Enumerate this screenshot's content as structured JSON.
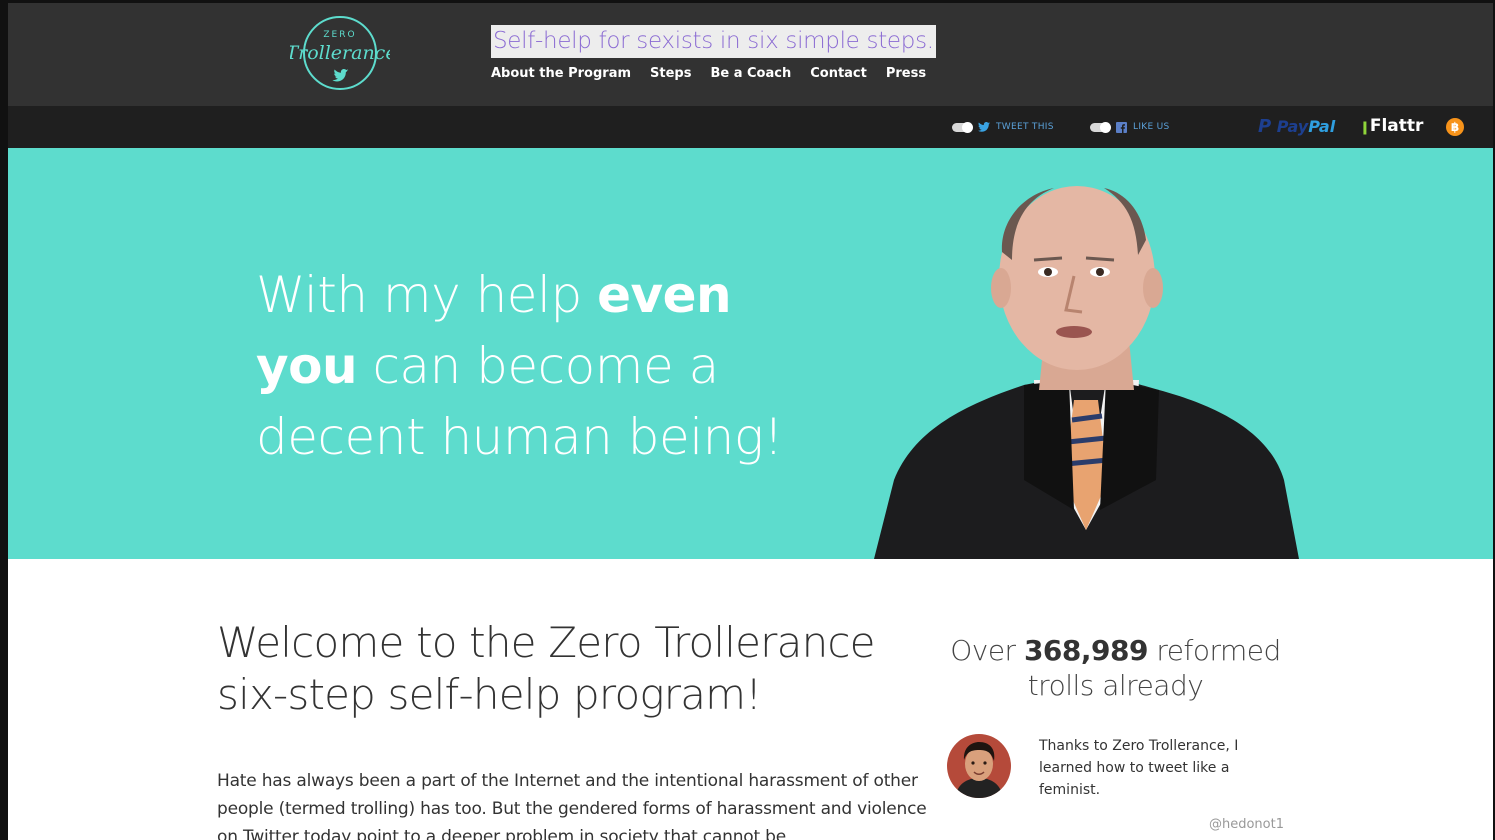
{
  "header": {
    "logo": {
      "top_text": "ZERO",
      "script_text": "Trollerance",
      "icon": "twitter-bird-icon",
      "color": "#5ddccd"
    },
    "tagline": "Self-help for sexists in six simple steps.",
    "nav": [
      {
        "label": "About the Program"
      },
      {
        "label": "Steps"
      },
      {
        "label": "Be a Coach"
      },
      {
        "label": "Contact"
      },
      {
        "label": "Press"
      }
    ]
  },
  "social_bar": {
    "tweet_label": "TWEET THIS",
    "like_label": "LIKE US",
    "paypal_label_1": "Pay",
    "paypal_label_2": "Pal",
    "flattr_label": "Flattr",
    "bitcoin_symbol": "฿"
  },
  "hero": {
    "line1_regular": "With my help ",
    "line1_bold": "even",
    "line2_bold": "you",
    "line2_regular": " can become a",
    "line3": "decent human being!",
    "background_color": "#5ddccd"
  },
  "content": {
    "welcome_title": "Welcome to the Zero Trollerance six-step self-help program!",
    "intro_paragraph": "Hate has always been a part of the Internet and the intentional harassment of other people (termed trolling) has too. But the gendered forms of harassment and violence on Twitter today point to a deeper problem in society that cannot be",
    "counter_prefix": "Over ",
    "counter_number": "368,989",
    "counter_suffix": " reformed trolls already",
    "testimonial": {
      "quote": "Thanks to Zero Trollerance, I learned how to tweet like a feminist.",
      "handle": "@hedonot1"
    }
  }
}
